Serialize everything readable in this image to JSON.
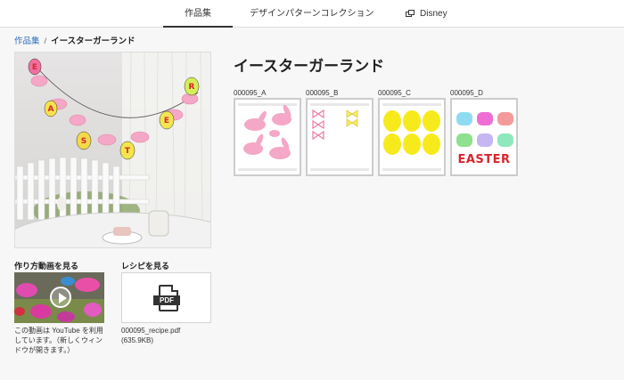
{
  "nav": {
    "tabs": [
      {
        "label": "作品集",
        "active": true
      },
      {
        "label": "デザインパターンコレクション"
      },
      {
        "label": "Disney",
        "icon": "windows-icon"
      }
    ]
  },
  "breadcrumb": {
    "parent": "作品集",
    "separator": "/",
    "current": "イースターガーランド"
  },
  "page": {
    "title": "イースターガーランド"
  },
  "patterns": [
    {
      "id": "000095_A"
    },
    {
      "id": "000095_B"
    },
    {
      "id": "000095_C"
    },
    {
      "id": "000095_D",
      "text": "EASTER"
    }
  ],
  "video": {
    "heading": "作り方動画を見る",
    "note": [
      "この動画は YouTube を利用",
      "しています。（新しくウィン",
      "ドウが開きます。）"
    ]
  },
  "recipe": {
    "heading": "レシピを見る",
    "file_name": "000095_recipe.pdf",
    "file_size": "(635.9KB)",
    "icon_text": "PDF"
  },
  "colors": {
    "link": "#2a6ebb",
    "pink": "#f4a7c6",
    "yellow": "#f7ea1c",
    "easter_red": "#d7262f"
  }
}
